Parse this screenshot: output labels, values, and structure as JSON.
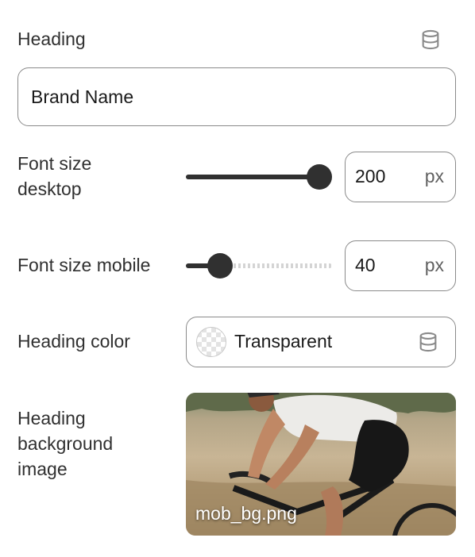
{
  "heading": {
    "label": "Heading",
    "value": "Brand Name",
    "dynamic_source_icon": "database-icon"
  },
  "font_size_desktop": {
    "label_line1": "Font size",
    "label_line2": "desktop",
    "value": "200",
    "unit": "px",
    "slider_fraction": 1.0
  },
  "font_size_mobile": {
    "label": "Font size mobile",
    "value": "40",
    "unit": "px",
    "slider_fraction": 0.18
  },
  "heading_color": {
    "label": "Heading color",
    "value": "Transparent",
    "swatch_icon": "transparent-checkerboard",
    "dynamic_source_icon": "database-icon"
  },
  "heading_background_image": {
    "label_line1": "Heading",
    "label_line2": "background",
    "label_line3": "image",
    "filename": "mob_bg.png"
  },
  "colors": {
    "text": "#303030",
    "border": "#8a8a8a",
    "slider": "#303030"
  }
}
